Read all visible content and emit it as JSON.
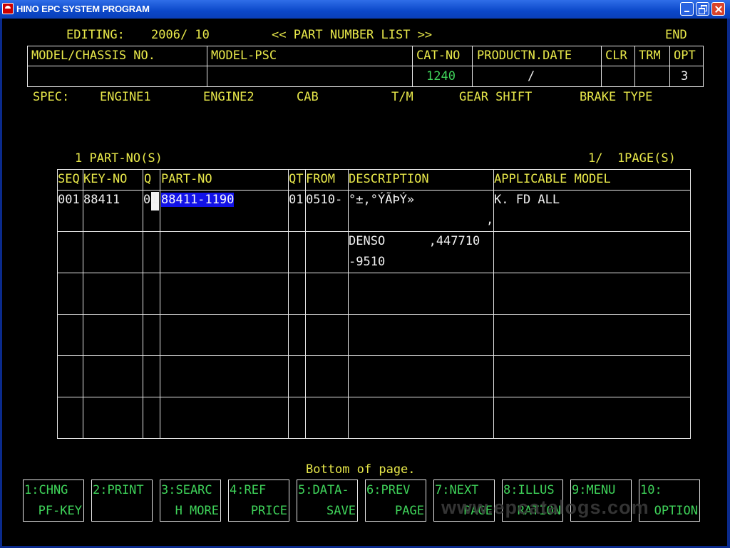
{
  "window": {
    "title": "HINO EPC SYSTEM PROGRAM",
    "icon": "hino-logo-icon"
  },
  "header": {
    "editing_label": "EDITING:",
    "editing_value": "2006/ 10",
    "screen_title": "<< PART NUMBER LIST >>",
    "end_label": "END"
  },
  "info_table": {
    "headers": [
      "MODEL/CHASSIS NO.",
      "MODEL-PSC",
      "CAT-NO",
      "PRODUCTN.DATE",
      "CLR",
      "TRM",
      "OPT"
    ],
    "values": {
      "model_chassis": "",
      "model_psc": "",
      "cat_no": "1240",
      "productn_date": "/",
      "clr": "",
      "trm": "",
      "opt": "3"
    }
  },
  "spec": {
    "label": "SPEC:",
    "items": [
      "ENGINE1",
      "ENGINE2",
      "CAB",
      "T/M",
      "GEAR SHIFT",
      "BRAKE TYPE"
    ]
  },
  "parts_summary": {
    "count": "1 PART-NO(S)",
    "page": "1/  1PAGE(S)"
  },
  "parts_table": {
    "headers": [
      "SEQ",
      "KEY-NO",
      "Q",
      "PART-NO",
      "QT",
      "FROM",
      "DESCRIPTION",
      "APPLICABLE MODEL"
    ],
    "rows": [
      {
        "seq": "001",
        "key_no": "88411",
        "q": "01",
        "part_no": "88411-1190",
        "qt": "01",
        "from": "0510-",
        "description": "°±,°ÝÃÞÝ»",
        "description_line2": ",",
        "applicable_model": "K. FD ALL"
      },
      {
        "description": "DENSO      ,447710",
        "description_line2": "-9510"
      }
    ]
  },
  "status": {
    "message": "Bottom of page."
  },
  "function_keys": [
    {
      "line1": "1:CHNG",
      "line2": "PF-KEY"
    },
    {
      "line1": "2:PRINT",
      "line2": ""
    },
    {
      "line1": "3:SEARC",
      "line2": "H MORE"
    },
    {
      "line1": "4:REF",
      "line2": "PRICE"
    },
    {
      "line1": "5:DATA-",
      "line2": "SAVE"
    },
    {
      "line1": "6:PREV",
      "line2": "PAGE"
    },
    {
      "line1": "7:NEXT",
      "line2": "PAGE"
    },
    {
      "line1": "8:ILLUS",
      "line2": "RATION"
    },
    {
      "line1": "9:MENU",
      "line2": ""
    },
    {
      "line1": "10:",
      "line2": "OPTION"
    }
  ],
  "watermark": "www.epcatalogs.com",
  "colors": {
    "screen_bg": "#000000",
    "label_yellow": "#e8e84a",
    "value_green": "#3fd45a",
    "text_white": "#f0f0f0",
    "selection_blue": "#1212e8",
    "titlebar_blue": "#0b47c9"
  }
}
